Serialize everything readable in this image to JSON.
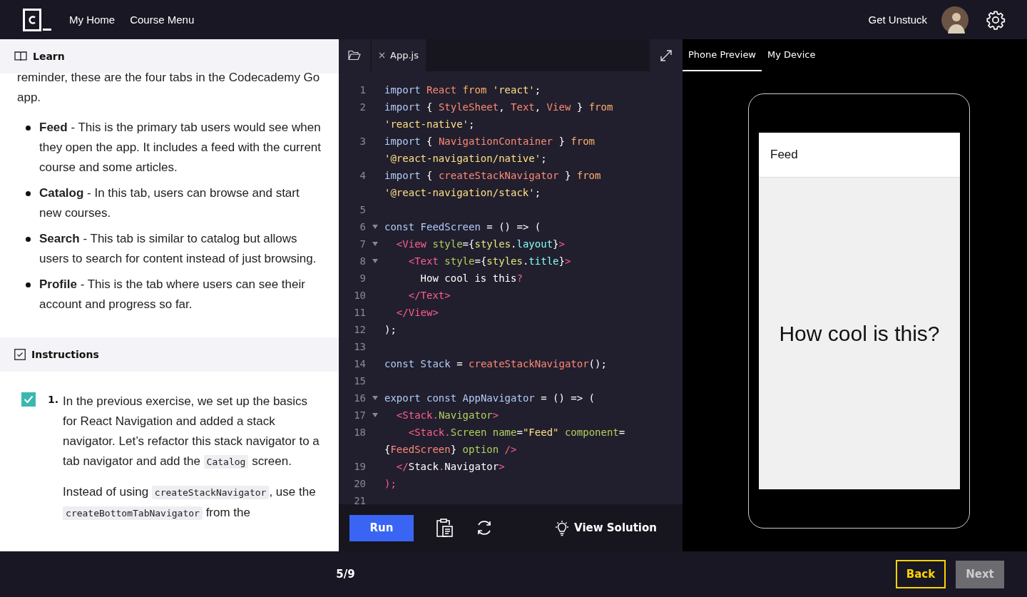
{
  "nav": {
    "links": [
      "My Home",
      "Course Menu"
    ],
    "help": "Get Unstuck"
  },
  "learn": {
    "title": "Learn",
    "intro": "reminder, these are the four tabs in the Codecademy Go app.",
    "bullets": [
      "**Feed** - This is the primary tab users would see when they open the app. It includes a feed with the current course and some articles.",
      "**Catalog** - In this tab, users can browse and start new courses.",
      "**Search** - This tab is similar to catalog but allows users to search for content instead of just browsing.",
      "**Profile** - This is the tab where users can see their account and progress so far."
    ]
  },
  "instructions": {
    "title": "Instructions",
    "tasks": [
      {
        "number": "1.",
        "checked": true,
        "paragraphs": [
          [
            {
              "text": "In the previous exercise, we set up the basics for React Navigation and added a stack navigator. Let’s refactor this stack navigator to a tab navigator and add the "
            },
            {
              "code": "Catalog"
            },
            {
              "text": " screen."
            }
          ],
          [
            {
              "text": "Instead of using "
            },
            {
              "code": "createStackNavigator"
            },
            {
              "text": ", use the "
            },
            {
              "code": "createBottomTabNavigator"
            },
            {
              "text": " from the"
            }
          ]
        ]
      }
    ]
  },
  "editor": {
    "file_tab": "App.js",
    "lines": [
      {
        "number": "1",
        "tokens": [
          {
            "text": "import ",
            "kind": "kw"
          },
          {
            "text": "React ",
            "kind": "name"
          },
          {
            "text": "from ",
            "kind": "from"
          },
          {
            "text": "'react'",
            "kind": "str"
          },
          {
            "text": ";",
            "kind": "plain"
          }
        ]
      },
      {
        "number": "2",
        "tokens": [
          {
            "text": "import ",
            "kind": "kw"
          },
          {
            "text": "{ ",
            "kind": "plain"
          },
          {
            "text": "StyleSheet",
            "kind": "name"
          },
          {
            "text": ", ",
            "kind": "plain"
          },
          {
            "text": "Text",
            "kind": "name"
          },
          {
            "text": ", ",
            "kind": "plain"
          },
          {
            "text": "View",
            "kind": "name"
          },
          {
            "text": " } ",
            "kind": "plain"
          },
          {
            "text": "from",
            "kind": "from"
          }
        ]
      },
      {
        "tokens": [
          {
            "text": "'react-native'",
            "kind": "str"
          },
          {
            "text": ";",
            "kind": "plain"
          }
        ]
      },
      {
        "number": "3",
        "tokens": [
          {
            "text": "import ",
            "kind": "kw"
          },
          {
            "text": "{ ",
            "kind": "plain"
          },
          {
            "text": "NavigationContainer",
            "kind": "name"
          },
          {
            "text": " } ",
            "kind": "plain"
          },
          {
            "text": "from",
            "kind": "from"
          }
        ]
      },
      {
        "tokens": [
          {
            "text": "'@react-navigation/native'",
            "kind": "str"
          },
          {
            "text": ";",
            "kind": "plain"
          }
        ]
      },
      {
        "number": "4",
        "tokens": [
          {
            "text": "import ",
            "kind": "kw"
          },
          {
            "text": "{ ",
            "kind": "plain"
          },
          {
            "text": "createStackNavigator",
            "kind": "name"
          },
          {
            "text": " } ",
            "kind": "plain"
          },
          {
            "text": "from",
            "kind": "from"
          }
        ]
      },
      {
        "tokens": [
          {
            "text": "'@react-navigation/stack'",
            "kind": "str"
          },
          {
            "text": ";",
            "kind": "plain"
          }
        ]
      },
      {
        "number": "5"
      },
      {
        "number": "6",
        "folded": false,
        "tokens": [
          {
            "text": "const ",
            "kind": "kw"
          },
          {
            "text": "FeedScreen",
            "kind": "id"
          },
          {
            "text": " = () => (",
            "kind": "plain"
          }
        ]
      },
      {
        "number": "7",
        "folded": false,
        "tokens": [
          {
            "text": "  <",
            "kind": "tag"
          },
          {
            "text": "View ",
            "kind": "tag"
          },
          {
            "text": "style",
            "kind": "attr"
          },
          {
            "text": "=",
            "kind": "plain"
          },
          {
            "text": "{",
            "kind": "plain"
          },
          {
            "text": "styles",
            "kind": "obj"
          },
          {
            "text": ".",
            "kind": "plain"
          },
          {
            "text": "layout",
            "kind": "prop"
          },
          {
            "text": "}",
            "kind": "plain"
          },
          {
            "text": ">",
            "kind": "tag"
          }
        ]
      },
      {
        "number": "8",
        "folded": false,
        "tokens": [
          {
            "text": "    <",
            "kind": "tag"
          },
          {
            "text": "Text ",
            "kind": "tag"
          },
          {
            "text": "style",
            "kind": "attr"
          },
          {
            "text": "=",
            "kind": "plain"
          },
          {
            "text": "{",
            "kind": "plain"
          },
          {
            "text": "styles",
            "kind": "obj"
          },
          {
            "text": ".",
            "kind": "plain"
          },
          {
            "text": "title",
            "kind": "prop"
          },
          {
            "text": "}",
            "kind": "plain"
          },
          {
            "text": ">",
            "kind": "tag"
          }
        ]
      },
      {
        "number": "9",
        "tokens": [
          {
            "text": "      How cool is this",
            "kind": "plain"
          },
          {
            "text": "?",
            "kind": "tag"
          }
        ]
      },
      {
        "number": "10",
        "tokens": [
          {
            "text": "    </Text>",
            "kind": "tag"
          }
        ]
      },
      {
        "number": "11",
        "tokens": [
          {
            "text": "  </View>",
            "kind": "tag"
          }
        ]
      },
      {
        "number": "12",
        "tokens": [
          {
            "text": ");",
            "kind": "plain"
          }
        ]
      },
      {
        "number": "13"
      },
      {
        "number": "14",
        "tokens": [
          {
            "text": "const ",
            "kind": "kw"
          },
          {
            "text": "Stack",
            "kind": "id"
          },
          {
            "text": " = ",
            "kind": "plain"
          },
          {
            "text": "createStackNavigator",
            "kind": "name"
          },
          {
            "text": "();",
            "kind": "plain"
          }
        ]
      },
      {
        "number": "15"
      },
      {
        "number": "16",
        "folded": false,
        "tokens": [
          {
            "text": "export ",
            "kind": "kw"
          },
          {
            "text": "const ",
            "kind": "kw"
          },
          {
            "text": "AppNavigator",
            "kind": "id"
          },
          {
            "text": " = () => (",
            "kind": "plain"
          }
        ]
      },
      {
        "number": "17",
        "folded": false,
        "tokens": [
          {
            "text": "  <",
            "kind": "tag"
          },
          {
            "text": "Stack",
            "kind": "tag"
          },
          {
            "text": ".",
            "kind": "tag"
          },
          {
            "text": "Navigator",
            "kind": "attr"
          },
          {
            "text": ">",
            "kind": "tag"
          }
        ]
      },
      {
        "number": "18",
        "tokens": [
          {
            "text": "    <",
            "kind": "tag"
          },
          {
            "text": "Stack",
            "kind": "tag"
          },
          {
            "text": ".",
            "kind": "tag"
          },
          {
            "text": "Screen ",
            "kind": "attr"
          },
          {
            "text": "name",
            "kind": "attr"
          },
          {
            "text": "=",
            "kind": "plain"
          },
          {
            "text": "\"Feed\"",
            "kind": "str"
          },
          {
            "text": " component",
            "kind": "attr"
          },
          {
            "text": "=",
            "kind": "plain"
          }
        ]
      },
      {
        "tokens": [
          {
            "text": "{",
            "kind": "plain"
          },
          {
            "text": "FeedScreen",
            "kind": "name"
          },
          {
            "text": "} ",
            "kind": "plain"
          },
          {
            "text": "option ",
            "kind": "attr"
          },
          {
            "text": "/>",
            "kind": "tag"
          }
        ]
      },
      {
        "number": "19",
        "tokens": [
          {
            "text": "  </",
            "kind": "tag"
          },
          {
            "text": "Stack",
            "kind": "plain"
          },
          {
            "text": ".",
            "kind": "tag"
          },
          {
            "text": "Navigator",
            "kind": "plain"
          },
          {
            "text": ">",
            "kind": "tag"
          }
        ]
      },
      {
        "number": "20",
        "tokens": [
          {
            "text": ");",
            "kind": "tag"
          }
        ]
      },
      {
        "number": "21"
      }
    ],
    "run": "Run",
    "solution": "View Solution"
  },
  "preview": {
    "tabs": [
      {
        "label": "Phone Preview",
        "selected": true
      },
      {
        "label": "My Device",
        "selected": false
      }
    ],
    "header": "Feed",
    "body": "How cool is this?"
  },
  "footer": {
    "progress": "5/9",
    "back": "Back",
    "next": "Next",
    "next_disabled": true
  }
}
